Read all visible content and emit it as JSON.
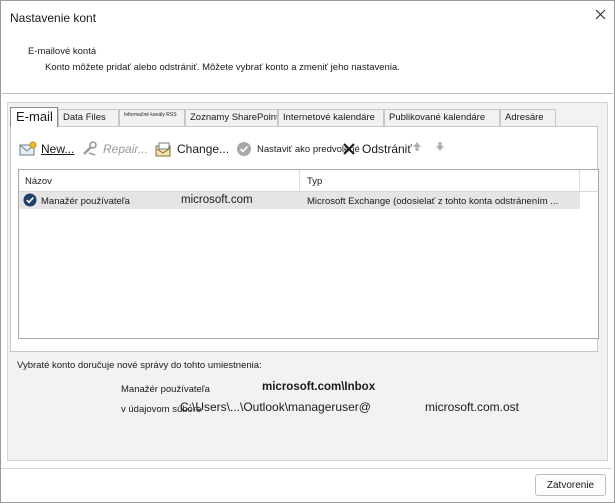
{
  "window": {
    "title": "Nastavenie kont"
  },
  "header": {
    "title": "E-mailové kontá",
    "description": "Konto môžete pridať alebo odstrániť. Môžete vybrať konto a zmeniť jeho nastavenia."
  },
  "tabs": [
    {
      "label": "E-mail",
      "active": true
    },
    {
      "label": "Data Files"
    },
    {
      "label": "Informačné kanály RSS"
    },
    {
      "label": "Zoznamy SharePointu"
    },
    {
      "label": "Internetové kalendáre"
    },
    {
      "label": "Publikované kalendáre"
    },
    {
      "label": "Adresáre"
    }
  ],
  "toolbar": {
    "new_label": "New...",
    "repair_label": "Repair...",
    "change_label": "Change...",
    "set_default_label": "Nastaviť ako predvolené",
    "remove_label": "Odstrániť",
    "icons": [
      "new-email-icon",
      "repair-icon",
      "change-icon",
      "check-circle-icon",
      "remove-x-icon",
      "arrow-up-icon",
      "arrow-down-icon"
    ]
  },
  "accounts_table": {
    "columns": [
      "Názov",
      "Typ"
    ],
    "rows": [
      {
        "name": "Manažér používateľa",
        "domain": "microsoft.com",
        "type": "Microsoft Exchange (odosielať z tohto konta odstránením ..."
      }
    ]
  },
  "delivery": {
    "label": "Vybraté konto doručuje nové správy do tohto umiestnenia:",
    "account": "Manažér používateľa",
    "inbox": "microsoft.com\\Inbox",
    "file_label": "v údajovom súbore",
    "file_path": "C:\\Users\\...\\Outlook\\manageruser@",
    "file_suffix": "microsoft.com.ost"
  },
  "footer": {
    "close_label": "Zatvorenie"
  },
  "colors": {
    "selected_row": "#e5e5e5",
    "dialog_body": "#f2f2f2",
    "accent": "#1f4e79"
  }
}
